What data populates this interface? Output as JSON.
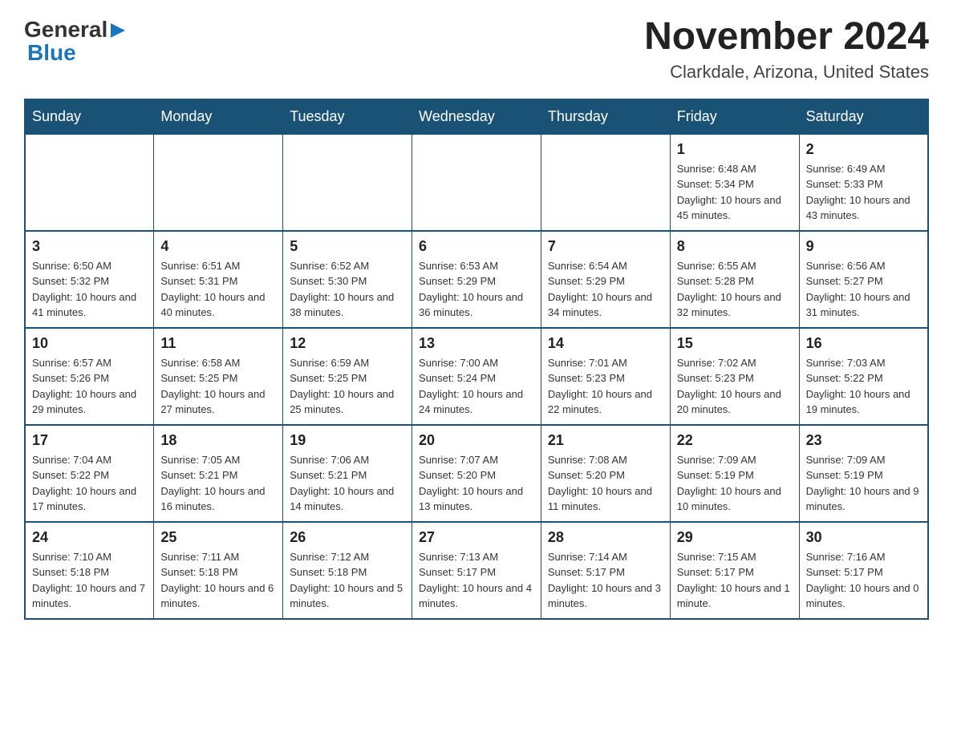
{
  "logo": {
    "general": "General",
    "blue": "Blue",
    "arrow": "▶"
  },
  "title": {
    "month_year": "November 2024",
    "location": "Clarkdale, Arizona, United States"
  },
  "days_of_week": [
    "Sunday",
    "Monday",
    "Tuesday",
    "Wednesday",
    "Thursday",
    "Friday",
    "Saturday"
  ],
  "weeks": [
    [
      {
        "day": "",
        "info": ""
      },
      {
        "day": "",
        "info": ""
      },
      {
        "day": "",
        "info": ""
      },
      {
        "day": "",
        "info": ""
      },
      {
        "day": "",
        "info": ""
      },
      {
        "day": "1",
        "info": "Sunrise: 6:48 AM\nSunset: 5:34 PM\nDaylight: 10 hours and 45 minutes."
      },
      {
        "day": "2",
        "info": "Sunrise: 6:49 AM\nSunset: 5:33 PM\nDaylight: 10 hours and 43 minutes."
      }
    ],
    [
      {
        "day": "3",
        "info": "Sunrise: 6:50 AM\nSunset: 5:32 PM\nDaylight: 10 hours and 41 minutes."
      },
      {
        "day": "4",
        "info": "Sunrise: 6:51 AM\nSunset: 5:31 PM\nDaylight: 10 hours and 40 minutes."
      },
      {
        "day": "5",
        "info": "Sunrise: 6:52 AM\nSunset: 5:30 PM\nDaylight: 10 hours and 38 minutes."
      },
      {
        "day": "6",
        "info": "Sunrise: 6:53 AM\nSunset: 5:29 PM\nDaylight: 10 hours and 36 minutes."
      },
      {
        "day": "7",
        "info": "Sunrise: 6:54 AM\nSunset: 5:29 PM\nDaylight: 10 hours and 34 minutes."
      },
      {
        "day": "8",
        "info": "Sunrise: 6:55 AM\nSunset: 5:28 PM\nDaylight: 10 hours and 32 minutes."
      },
      {
        "day": "9",
        "info": "Sunrise: 6:56 AM\nSunset: 5:27 PM\nDaylight: 10 hours and 31 minutes."
      }
    ],
    [
      {
        "day": "10",
        "info": "Sunrise: 6:57 AM\nSunset: 5:26 PM\nDaylight: 10 hours and 29 minutes."
      },
      {
        "day": "11",
        "info": "Sunrise: 6:58 AM\nSunset: 5:25 PM\nDaylight: 10 hours and 27 minutes."
      },
      {
        "day": "12",
        "info": "Sunrise: 6:59 AM\nSunset: 5:25 PM\nDaylight: 10 hours and 25 minutes."
      },
      {
        "day": "13",
        "info": "Sunrise: 7:00 AM\nSunset: 5:24 PM\nDaylight: 10 hours and 24 minutes."
      },
      {
        "day": "14",
        "info": "Sunrise: 7:01 AM\nSunset: 5:23 PM\nDaylight: 10 hours and 22 minutes."
      },
      {
        "day": "15",
        "info": "Sunrise: 7:02 AM\nSunset: 5:23 PM\nDaylight: 10 hours and 20 minutes."
      },
      {
        "day": "16",
        "info": "Sunrise: 7:03 AM\nSunset: 5:22 PM\nDaylight: 10 hours and 19 minutes."
      }
    ],
    [
      {
        "day": "17",
        "info": "Sunrise: 7:04 AM\nSunset: 5:22 PM\nDaylight: 10 hours and 17 minutes."
      },
      {
        "day": "18",
        "info": "Sunrise: 7:05 AM\nSunset: 5:21 PM\nDaylight: 10 hours and 16 minutes."
      },
      {
        "day": "19",
        "info": "Sunrise: 7:06 AM\nSunset: 5:21 PM\nDaylight: 10 hours and 14 minutes."
      },
      {
        "day": "20",
        "info": "Sunrise: 7:07 AM\nSunset: 5:20 PM\nDaylight: 10 hours and 13 minutes."
      },
      {
        "day": "21",
        "info": "Sunrise: 7:08 AM\nSunset: 5:20 PM\nDaylight: 10 hours and 11 minutes."
      },
      {
        "day": "22",
        "info": "Sunrise: 7:09 AM\nSunset: 5:19 PM\nDaylight: 10 hours and 10 minutes."
      },
      {
        "day": "23",
        "info": "Sunrise: 7:09 AM\nSunset: 5:19 PM\nDaylight: 10 hours and 9 minutes."
      }
    ],
    [
      {
        "day": "24",
        "info": "Sunrise: 7:10 AM\nSunset: 5:18 PM\nDaylight: 10 hours and 7 minutes."
      },
      {
        "day": "25",
        "info": "Sunrise: 7:11 AM\nSunset: 5:18 PM\nDaylight: 10 hours and 6 minutes."
      },
      {
        "day": "26",
        "info": "Sunrise: 7:12 AM\nSunset: 5:18 PM\nDaylight: 10 hours and 5 minutes."
      },
      {
        "day": "27",
        "info": "Sunrise: 7:13 AM\nSunset: 5:17 PM\nDaylight: 10 hours and 4 minutes."
      },
      {
        "day": "28",
        "info": "Sunrise: 7:14 AM\nSunset: 5:17 PM\nDaylight: 10 hours and 3 minutes."
      },
      {
        "day": "29",
        "info": "Sunrise: 7:15 AM\nSunset: 5:17 PM\nDaylight: 10 hours and 1 minute."
      },
      {
        "day": "30",
        "info": "Sunrise: 7:16 AM\nSunset: 5:17 PM\nDaylight: 10 hours and 0 minutes."
      }
    ]
  ]
}
